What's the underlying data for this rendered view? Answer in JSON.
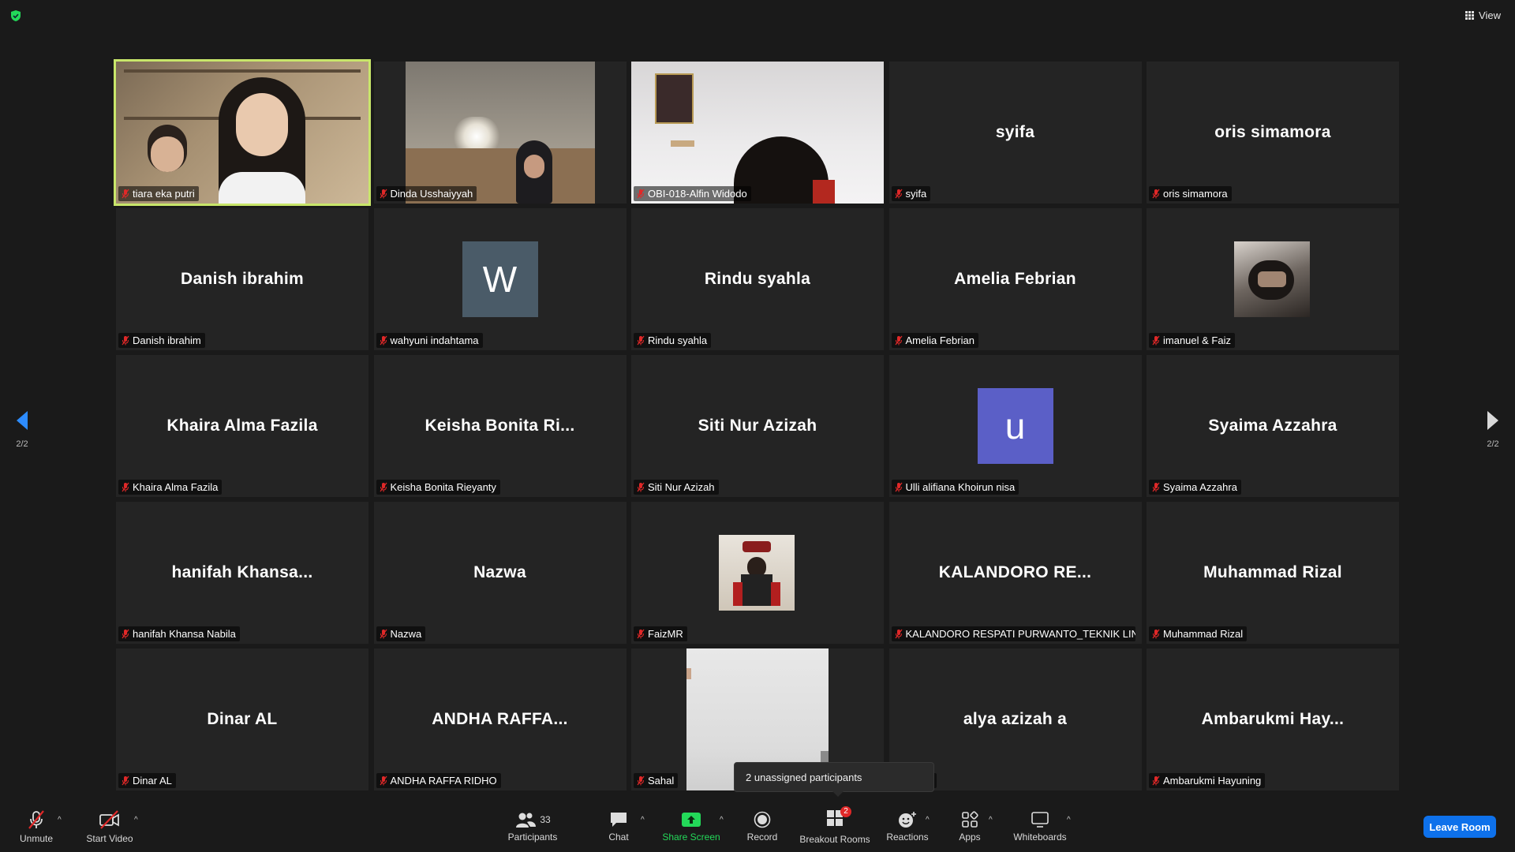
{
  "top": {
    "view_label": "View"
  },
  "page_indicator": {
    "left": "2/2",
    "right": "2/2"
  },
  "colors": {
    "active_speaker": "#c8e66a",
    "accent": "#0e71eb",
    "share_green": "#23d959",
    "mic_off_red": "#e02828"
  },
  "tiles": [
    {
      "label": "tiara eka putri",
      "type": "video",
      "active": true
    },
    {
      "label": "Dinda Usshaiyyah",
      "type": "video"
    },
    {
      "label": "OBI-018-Alfin Widodo",
      "type": "video"
    },
    {
      "label": "syifa",
      "center": "syifa",
      "type": "name"
    },
    {
      "label": "oris simamora",
      "center": "oris simamora",
      "type": "name"
    },
    {
      "label": "Danish ibrahim",
      "center": "Danish ibrahim",
      "type": "name"
    },
    {
      "label": "wahyuni indahtama",
      "center": "W",
      "type": "avatar",
      "avatar_color": "#4a5b68"
    },
    {
      "label": "Rindu syahla",
      "center": "Rindu syahla",
      "type": "name"
    },
    {
      "label": "Amelia Febrian",
      "center": "Amelia Febrian",
      "type": "name"
    },
    {
      "label": "imanuel & Faiz",
      "type": "photo"
    },
    {
      "label": "Khaira Alma Fazila",
      "center": "Khaira Alma Fazila",
      "type": "name"
    },
    {
      "label": "Keisha Bonita Rieyanty",
      "center": "Keisha  Bonita  Ri...",
      "type": "name"
    },
    {
      "label": "Siti Nur Azizah",
      "center": "Siti Nur Azizah",
      "type": "name"
    },
    {
      "label": "Ulli alifiana Khoirun nisa",
      "center": "u",
      "type": "avatar",
      "avatar_color": "#5b5fc7"
    },
    {
      "label": "Syaima Azzahra",
      "center": "Syaima Azzahra",
      "type": "name"
    },
    {
      "label": "hanifah Khansa Nabila",
      "center": "hanifah  Khansa...",
      "type": "name"
    },
    {
      "label": "Nazwa",
      "center": "Nazwa",
      "type": "name"
    },
    {
      "label": "FaizMR",
      "type": "photo"
    },
    {
      "label": "KALANDORO RESPATI PURWANTO_TEKNIK LING...",
      "center": "KALANDORO  RE...",
      "type": "name"
    },
    {
      "label": "Muhammad Rizal",
      "center": "Muhammad Rizal",
      "type": "name"
    },
    {
      "label": "Dinar AL",
      "center": "Dinar AL",
      "type": "name"
    },
    {
      "label": "ANDHA RAFFA RIDHO",
      "center": "ANDHA  RAFFA...",
      "type": "name"
    },
    {
      "label": "Sahal",
      "type": "video"
    },
    {
      "label": "izah a",
      "center": "alya azizah a",
      "type": "name"
    },
    {
      "label": "Ambarukmi Hayuning",
      "center": "Ambarukmi  Hay...",
      "type": "name"
    }
  ],
  "tooltip": "2 unassigned participants",
  "toolbar": {
    "unmute": "Unmute",
    "start_video": "Start Video",
    "participants": "Participants",
    "participants_count": "33",
    "chat": "Chat",
    "share_screen": "Share Screen",
    "record": "Record",
    "breakout_rooms": "Breakout Rooms",
    "breakout_badge": "2",
    "reactions": "Reactions",
    "apps": "Apps",
    "whiteboards": "Whiteboards",
    "leave_room": "Leave Room"
  }
}
